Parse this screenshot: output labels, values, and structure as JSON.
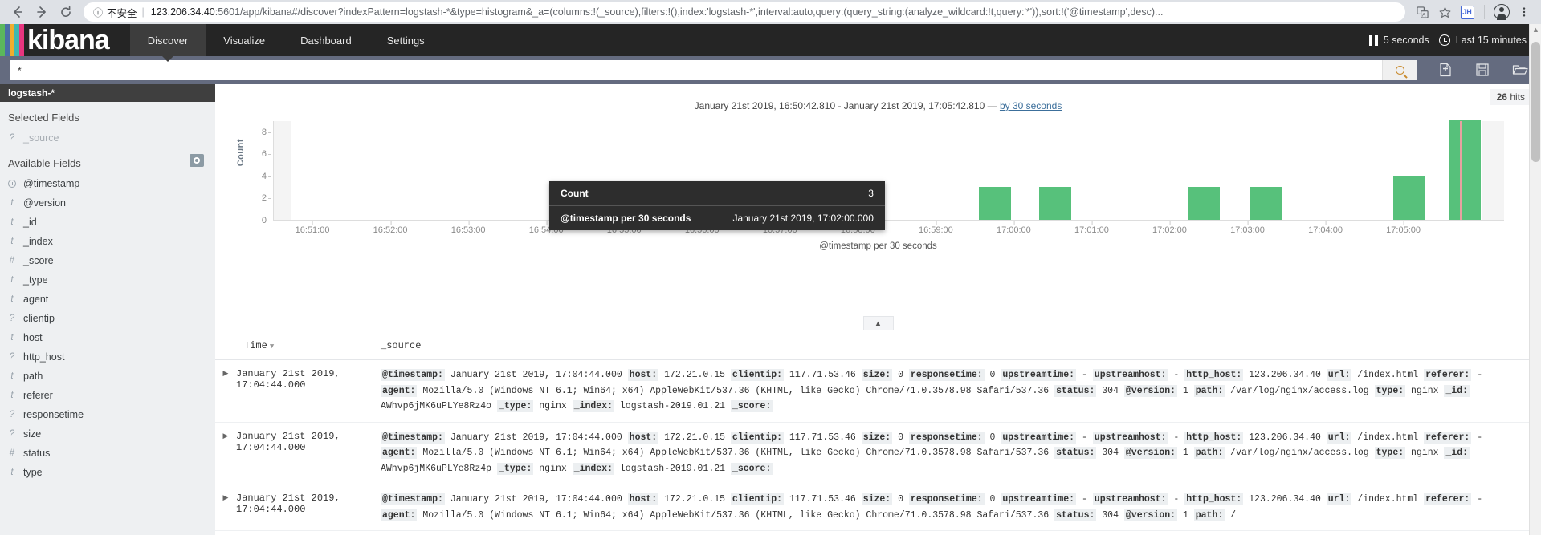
{
  "browser": {
    "back_icon": "back-arrow-icon",
    "forward_icon": "forward-arrow-icon",
    "reload_icon": "reload-icon",
    "info_icon": "info-circle-icon",
    "security_label": "不安全",
    "url_host": "123.206.34.40",
    "url_rest": ":5601/app/kibana#/discover?indexPattern=logstash-*&type=histogram&_a=(columns:!(_source),filters:!(),index:'logstash-*',interval:auto,query:(query_string:(analyze_wildcard:!t,query:'*')),sort:!('@timestamp',desc)...",
    "translate_icon": "translate-icon",
    "bookmark_icon": "star-icon",
    "extension_badge": "JH",
    "profile_icon": "profile-avatar-icon",
    "menu_icon": "kebab-menu-icon"
  },
  "header": {
    "logo_text": "kibana",
    "logo_colors": [
      "#5bb85b",
      "#4a6fa5",
      "#f0ad2e",
      "#3fb8b0",
      "#e8357f"
    ],
    "nav": [
      {
        "label": "Discover",
        "active": true
      },
      {
        "label": "Visualize",
        "active": false
      },
      {
        "label": "Dashboard",
        "active": false
      },
      {
        "label": "Settings",
        "active": false
      }
    ],
    "refresh_interval": "5 seconds",
    "time_range": "Last 15 minutes",
    "pause_icon": "pause-icon",
    "clock_icon": "clock-icon"
  },
  "search": {
    "query": "*",
    "placeholder": "",
    "search_icon": "search-magnifier-icon",
    "new_icon": "new-search-icon",
    "save_icon": "save-floppy-icon",
    "open_icon": "open-folder-icon"
  },
  "sidebar": {
    "index_pattern": "logstash-*",
    "collapse_icon": "chevron-left-icon",
    "selected_fields_label": "Selected Fields",
    "available_fields_label": "Available Fields",
    "settings_icon": "gear-icon",
    "selected_fields": [
      {
        "name": "_source",
        "type": "?"
      }
    ],
    "available_fields": [
      {
        "name": "@timestamp",
        "type": "clock"
      },
      {
        "name": "@version",
        "type": "t"
      },
      {
        "name": "_id",
        "type": "t"
      },
      {
        "name": "_index",
        "type": "t"
      },
      {
        "name": "_score",
        "type": "#"
      },
      {
        "name": "_type",
        "type": "t"
      },
      {
        "name": "agent",
        "type": "t"
      },
      {
        "name": "clientip",
        "type": "?"
      },
      {
        "name": "host",
        "type": "t"
      },
      {
        "name": "http_host",
        "type": "?"
      },
      {
        "name": "path",
        "type": "t"
      },
      {
        "name": "referer",
        "type": "t"
      },
      {
        "name": "responsetime",
        "type": "?"
      },
      {
        "name": "size",
        "type": "?"
      },
      {
        "name": "status",
        "type": "#"
      },
      {
        "name": "type",
        "type": "t"
      }
    ]
  },
  "main": {
    "hits_count": "26",
    "hits_label": "hits",
    "chart_range_text": "January 21st 2019, 16:50:42.810 - January 21st 2019, 17:05:42.810 — ",
    "chart_interval_link": "by 30 seconds",
    "collapse_chart_icon": "chevron-up-icon",
    "tooltip": {
      "count_label": "Count",
      "count_value": "3",
      "bucket_label": "@timestamp per 30 seconds",
      "bucket_value": "January 21st 2019, 17:02:00.000"
    }
  },
  "chart_data": {
    "type": "bar",
    "title": "",
    "xlabel": "@timestamp per 30 seconds",
    "ylabel": "Count",
    "ylim": [
      0,
      9
    ],
    "yticks": [
      0,
      2,
      4,
      6,
      8
    ],
    "xticks": [
      "16:51:00",
      "16:52:00",
      "16:53:00",
      "16:54:00",
      "16:55:00",
      "16:56:00",
      "16:57:00",
      "16:58:00",
      "16:59:00",
      "17:00:00",
      "17:01:00",
      "17:02:00",
      "17:03:00",
      "17:04:00",
      "17:05:00"
    ],
    "grid": false,
    "legend": "none",
    "bar_color": "#57c17b",
    "categories": [
      "16:59:30",
      "17:00:00",
      "17:01:30",
      "17:02:00",
      "17:04:00",
      "17:04:30"
    ],
    "values": [
      3,
      3,
      3,
      3,
      4,
      9
    ],
    "bar_positions_pct": [
      57.3,
      62.2,
      74.3,
      79.3,
      91.0,
      95.5
    ]
  },
  "table": {
    "columns": [
      {
        "label": "Time",
        "sorted": true,
        "sort_icon": "sort-desc-caret"
      },
      {
        "label": "_source",
        "sorted": false
      }
    ],
    "rows": [
      {
        "expander_icon": "expand-row-icon",
        "time": "January 21st 2019, 17:04:44.000",
        "fields": [
          {
            "k": "@timestamp:",
            "v": "January 21st 2019, 17:04:44.000"
          },
          {
            "k": "host:",
            "v": "172.21.0.15"
          },
          {
            "k": "clientip:",
            "v": "117.71.53.46"
          },
          {
            "k": "size:",
            "v": "0"
          },
          {
            "k": "responsetime:",
            "v": "0"
          },
          {
            "k": "upstreamtime:",
            "v": "-"
          },
          {
            "k": "upstreamhost:",
            "v": "-"
          },
          {
            "k": "http_host:",
            "v": "123.206.34.40"
          },
          {
            "k": "url:",
            "v": "/index.html"
          },
          {
            "k": "referer:",
            "v": "-"
          },
          {
            "k": "agent:",
            "v": "Mozilla/5.0 (Windows NT 6.1; Win64; x64) AppleWebKit/537.36 (KHTML, like Gecko) Chrome/71.0.3578.98 Safari/537.36"
          },
          {
            "k": "status:",
            "v": "304"
          },
          {
            "k": "@version:",
            "v": "1"
          },
          {
            "k": "path:",
            "v": "/var/log/nginx/access.log"
          },
          {
            "k": "type:",
            "v": "nginx"
          },
          {
            "k": "_id:",
            "v": "AWhvp6jMK6uPLYe8Rz4o"
          },
          {
            "k": "_type:",
            "v": "nginx"
          },
          {
            "k": "_index:",
            "v": "logstash-2019.01.21"
          },
          {
            "k": "_score:",
            "v": ""
          }
        ]
      },
      {
        "expander_icon": "expand-row-icon",
        "time": "January 21st 2019, 17:04:44.000",
        "fields": [
          {
            "k": "@timestamp:",
            "v": "January 21st 2019, 17:04:44.000"
          },
          {
            "k": "host:",
            "v": "172.21.0.15"
          },
          {
            "k": "clientip:",
            "v": "117.71.53.46"
          },
          {
            "k": "size:",
            "v": "0"
          },
          {
            "k": "responsetime:",
            "v": "0"
          },
          {
            "k": "upstreamtime:",
            "v": "-"
          },
          {
            "k": "upstreamhost:",
            "v": "-"
          },
          {
            "k": "http_host:",
            "v": "123.206.34.40"
          },
          {
            "k": "url:",
            "v": "/index.html"
          },
          {
            "k": "referer:",
            "v": "-"
          },
          {
            "k": "agent:",
            "v": "Mozilla/5.0 (Windows NT 6.1; Win64; x64) AppleWebKit/537.36 (KHTML, like Gecko) Chrome/71.0.3578.98 Safari/537.36"
          },
          {
            "k": "status:",
            "v": "304"
          },
          {
            "k": "@version:",
            "v": "1"
          },
          {
            "k": "path:",
            "v": "/var/log/nginx/access.log"
          },
          {
            "k": "type:",
            "v": "nginx"
          },
          {
            "k": "_id:",
            "v": "AWhvp6jMK6uPLYe8Rz4p"
          },
          {
            "k": "_type:",
            "v": "nginx"
          },
          {
            "k": "_index:",
            "v": "logstash-2019.01.21"
          },
          {
            "k": "_score:",
            "v": ""
          }
        ]
      },
      {
        "expander_icon": "expand-row-icon",
        "time": "January 21st 2019, 17:04:44.000",
        "fields": [
          {
            "k": "@timestamp:",
            "v": "January 21st 2019, 17:04:44.000"
          },
          {
            "k": "host:",
            "v": "172.21.0.15"
          },
          {
            "k": "clientip:",
            "v": "117.71.53.46"
          },
          {
            "k": "size:",
            "v": "0"
          },
          {
            "k": "responsetime:",
            "v": "0"
          },
          {
            "k": "upstreamtime:",
            "v": "-"
          },
          {
            "k": "upstreamhost:",
            "v": "-"
          },
          {
            "k": "http_host:",
            "v": "123.206.34.40"
          },
          {
            "k": "url:",
            "v": "/index.html"
          },
          {
            "k": "referer:",
            "v": "-"
          },
          {
            "k": "agent:",
            "v": "Mozilla/5.0 (Windows NT 6.1; Win64; x64) AppleWebKit/537.36 (KHTML, like Gecko) Chrome/71.0.3578.98 Safari/537.36"
          },
          {
            "k": "status:",
            "v": "304"
          },
          {
            "k": "@version:",
            "v": "1"
          },
          {
            "k": "path:",
            "v": "/"
          }
        ]
      }
    ]
  }
}
